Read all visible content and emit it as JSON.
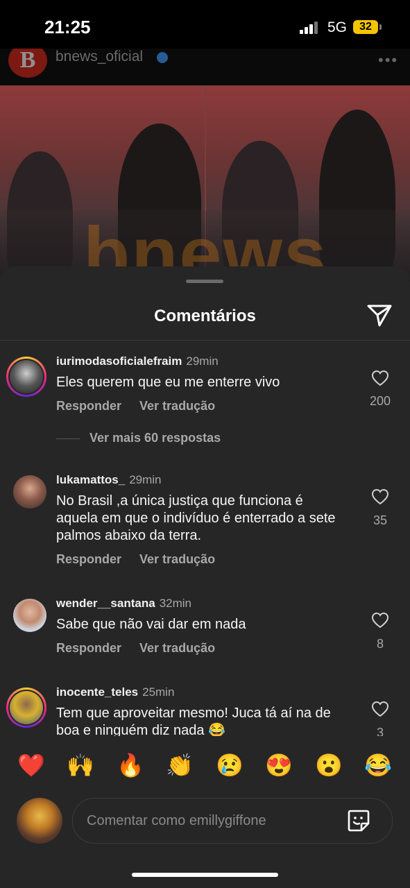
{
  "status_bar": {
    "time": "21:25",
    "network": "5G",
    "battery": "32"
  },
  "post": {
    "username": "bnews_oficial",
    "avatar_letter": "B",
    "watermark": "bnews"
  },
  "sheet": {
    "title": "Comentários"
  },
  "comments": [
    {
      "username": "iurimodasoficialefraim",
      "time": "29min",
      "text": "Eles querem que eu me enterre vivo",
      "likes": "200",
      "reply": "Responder",
      "translate": "Ver tradução",
      "more_replies": "Ver mais 60 respostas"
    },
    {
      "username": "lukamattos_",
      "time": "29min",
      "text": "No Brasil ,a única justiça que funciona é aquela em que o indivíduo é enterrado a sete palmos abaixo da terra.",
      "likes": "35",
      "reply": "Responder",
      "translate": "Ver tradução"
    },
    {
      "username": "wender__santana",
      "time": "32min",
      "text": "Sabe que não vai dar em nada",
      "likes": "8",
      "reply": "Responder",
      "translate": "Ver tradução"
    },
    {
      "username": "inocente_teles",
      "time": "25min",
      "text": "Tem que aproveitar mesmo! Juca tá aí na de boa e ninguém diz nada 😂",
      "likes": "3"
    }
  ],
  "reactions": [
    "❤️",
    "🙌",
    "🔥",
    "👏",
    "😢",
    "😍",
    "😮",
    "😂"
  ],
  "composer": {
    "placeholder": "Comentar como emillygiffone"
  },
  "colors": {
    "sheet_bg": "#262626",
    "text_secondary": "#a8a8a8",
    "battery": "#f5c400"
  }
}
